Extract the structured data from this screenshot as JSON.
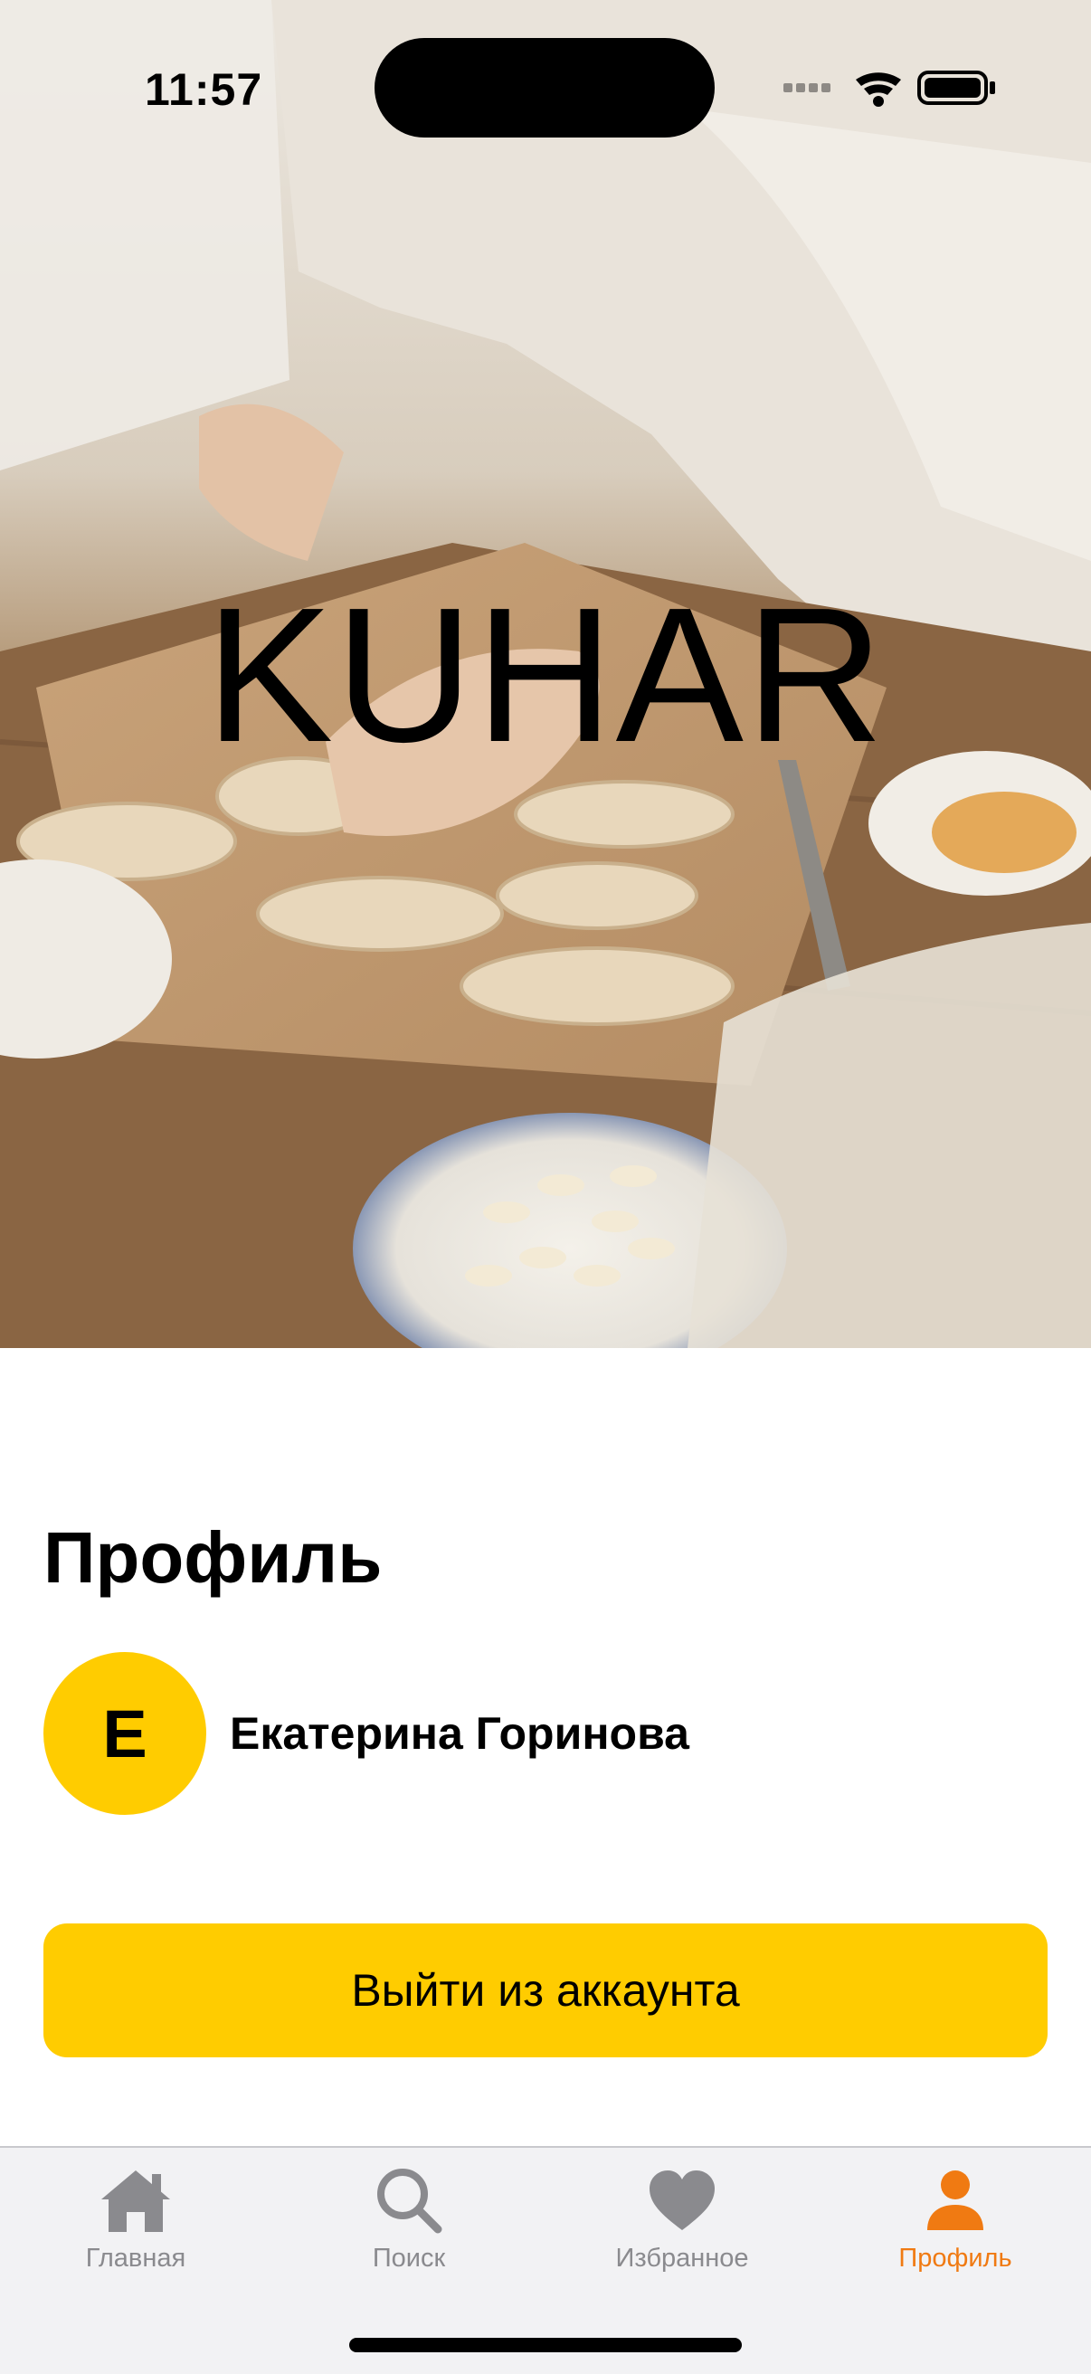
{
  "status_bar": {
    "time": "11:57"
  },
  "hero": {
    "title": "KUHAR"
  },
  "profile": {
    "title": "Профиль",
    "avatar_letter": "E",
    "user_name": "Екатерина Горинова",
    "logout_label": "Выйти из аккаунта"
  },
  "tab_bar": {
    "tabs": [
      {
        "label": "Главная",
        "icon": "home-icon",
        "active": false
      },
      {
        "label": "Поиск",
        "icon": "search-icon",
        "active": false
      },
      {
        "label": "Избранное",
        "icon": "heart-icon",
        "active": false
      },
      {
        "label": "Профиль",
        "icon": "person-icon",
        "active": true
      }
    ]
  },
  "colors": {
    "accent_yellow": "#FFCC00",
    "active_tab": "#F07A12",
    "inactive_tab": "#8A8A8E",
    "tab_bar_bg": "#F2F2F4"
  }
}
